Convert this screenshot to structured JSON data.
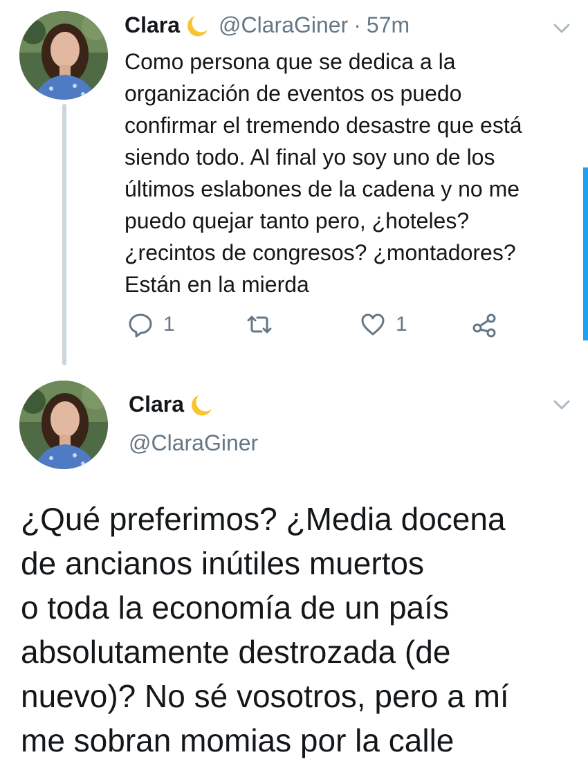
{
  "thread": {
    "tweet1": {
      "display_name": "Clara",
      "emoji": "crescent-moon",
      "handle": "@ClaraGiner",
      "separator": "·",
      "time": "57m",
      "text_lines": [
        "Como persona que se dedica a la",
        "organización de eventos os puedo",
        "confirmar el tremendo desastre que está",
        "siendo todo. Al final yo soy uno de los",
        "últimos eslabones de la cadena y no me",
        "puedo quejar tanto pero, ¿hoteles?",
        "¿recintos de congresos? ¿montadores?",
        "Están en la mierda"
      ],
      "actions": {
        "reply_count": "1",
        "retweet_count": "",
        "like_count": "1"
      }
    },
    "tweet2": {
      "display_name": "Clara",
      "emoji": "crescent-moon",
      "handle": "@ClaraGiner",
      "text_lines": [
        "¿Qué preferimos? ¿Media docena",
        "de ancianos inútiles muertos",
        "o toda la economía de un país",
        "absolutamente destrozada (de",
        "nuevo)? No sé vosotros, pero a mí",
        "me sobran momias por la calle"
      ]
    }
  },
  "colors": {
    "text": "#14171a",
    "secondary": "#657786",
    "thread_line": "#ccd6dd",
    "accent": "#1da1f2"
  },
  "icons": [
    "reply-icon",
    "retweet-icon",
    "like-icon",
    "share-icon",
    "chevron-down-icon",
    "moon-icon"
  ]
}
